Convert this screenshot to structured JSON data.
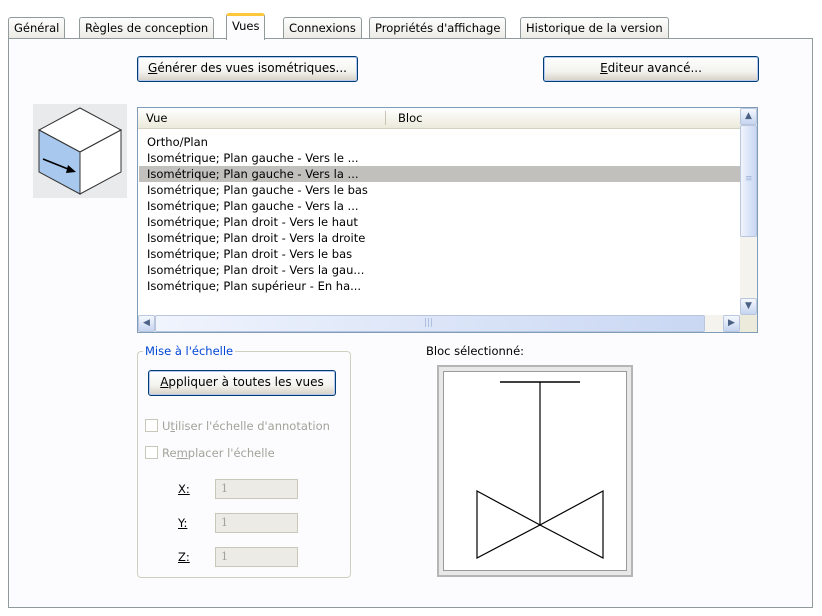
{
  "tabs": [
    {
      "label": "Général",
      "active": false
    },
    {
      "label": "Règles de conception",
      "active": false
    },
    {
      "label": "Vues",
      "active": true
    },
    {
      "label": "Connexions",
      "active": false
    },
    {
      "label": "Propriétés d'affichage",
      "active": false
    },
    {
      "label": "Historique de la version",
      "active": false
    }
  ],
  "buttons": {
    "generate_iso_first": "G",
    "generate_iso_rest": "énérer des vues isométriques...",
    "advanced_editor_first": "E",
    "advanced_editor_rest": "diteur avancé..."
  },
  "views_list": {
    "columns": [
      "Vue",
      "Bloc"
    ],
    "rows": [
      "Ortho/Plan",
      "Isométrique; Plan gauche - Vers le ...",
      "Isométrique; Plan gauche - Vers la ...",
      "Isométrique; Plan gauche - Vers le bas",
      "Isométrique; Plan gauche - Vers la ...",
      "Isométrique; Plan droit - Vers le haut",
      "Isométrique; Plan droit - Vers la droite",
      "Isométrique; Plan droit - Vers le bas",
      "Isométrique; Plan droit - Vers la gau...",
      "Isométrique; Plan supérieur - En ha..."
    ],
    "selected_index": 2
  },
  "scaling": {
    "legend": "Mise à l'échelle",
    "apply_first": "A",
    "apply_rest": "ppliquer à toutes les vues",
    "use_annotation_pre": "U",
    "use_annotation_u": "t",
    "use_annotation_rest": "iliser l'échelle d'annotation",
    "replace_pre": "Re",
    "replace_u": "m",
    "replace_rest": "placer l'échelle",
    "x_label": "X:",
    "y_label": "Y:",
    "z_label": "Z:",
    "x_value": "1",
    "y_value": "1",
    "z_value": "1"
  },
  "preview": {
    "label": "Bloc sélectionné:"
  },
  "colors": {
    "selection": "#c1c0bd",
    "tab_highlight": "#ffc83c",
    "group_legend": "#0046d5",
    "cube_face": "#a9c8ee"
  },
  "icons": [
    "iso-cube-icon",
    "scroll-up-icon",
    "scroll-down-icon",
    "scroll-left-icon",
    "scroll-right-icon"
  ]
}
